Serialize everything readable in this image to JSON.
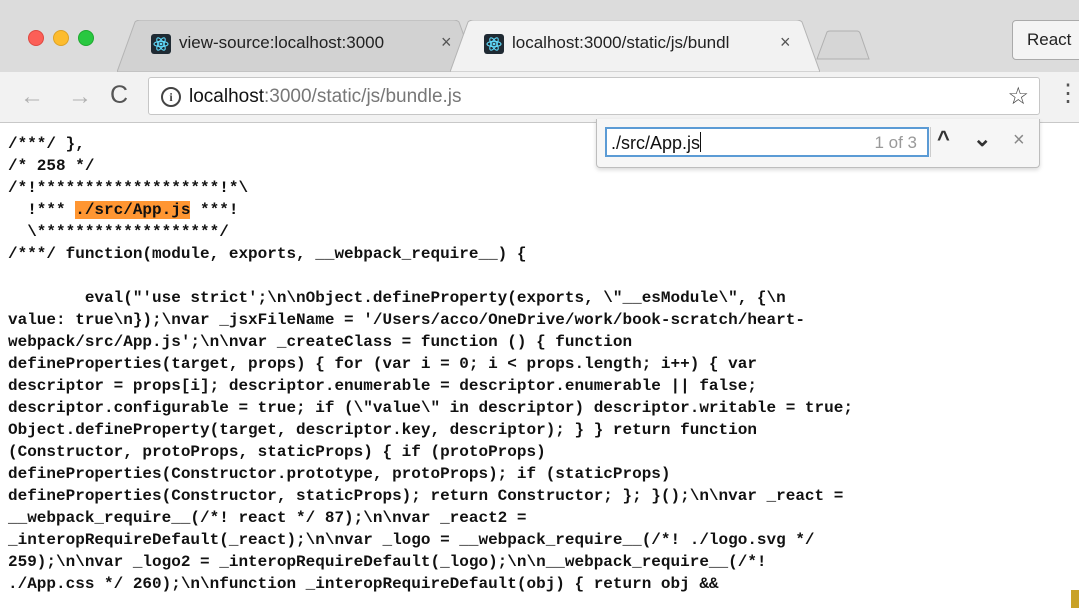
{
  "window": {
    "tabs": [
      {
        "title": "view-source:localhost:3000",
        "close": "×",
        "favicon": "react-icon"
      },
      {
        "title": "localhost:3000/static/js/bundl",
        "close": "×",
        "favicon": "react-icon"
      }
    ],
    "profile_label": "React"
  },
  "toolbar": {
    "back_icon": "←",
    "forward_icon": "→",
    "reload_icon": "C",
    "info_icon": "i",
    "url_host": "localhost",
    "url_path": ":3000/static/js/bundle.js",
    "star_icon": "☆",
    "menu_icon": "⋮"
  },
  "find": {
    "query": "./src/App.js",
    "count": "1 of 3",
    "prev_icon": "^",
    "next_icon": "⌄",
    "close_icon": "×"
  },
  "source": {
    "lines_before": [
      "/***/ },",
      "/* 258 */",
      "/*!*******************!*\\"
    ],
    "highlight_prefix": "  !*** ",
    "highlight_text": "./src/App.js",
    "highlight_suffix": " ***!",
    "lines_after": [
      "  \\*******************/",
      "/***/ function(module, exports, __webpack_require__) {",
      "",
      "        eval(\"'use strict';\\n\\nObject.defineProperty(exports, \\\"__esModule\\\", {\\n",
      "value: true\\n});\\nvar _jsxFileName = '/Users/acco/OneDrive/work/book-scratch/heart-",
      "webpack/src/App.js';\\n\\nvar _createClass = function () { function",
      "defineProperties(target, props) { for (var i = 0; i < props.length; i++) { var",
      "descriptor = props[i]; descriptor.enumerable = descriptor.enumerable || false;",
      "descriptor.configurable = true; if (\\\"value\\\" in descriptor) descriptor.writable = true;",
      "Object.defineProperty(target, descriptor.key, descriptor); } } return function",
      "(Constructor, protoProps, staticProps) { if (protoProps)",
      "defineProperties(Constructor.prototype, protoProps); if (staticProps)",
      "defineProperties(Constructor, staticProps); return Constructor; }; }();\\n\\nvar _react =",
      "__webpack_require__(/*! react */ 87);\\n\\nvar _react2 =",
      "_interopRequireDefault(_react);\\n\\nvar _logo = __webpack_require__(/*! ./logo.svg */",
      "259);\\n\\nvar _logo2 = _interopRequireDefault(_logo);\\n\\n__webpack_require__(/*!",
      "./App.css */ 260);\\n\\nfunction _interopRequireDefault(obj) { return obj &&"
    ]
  }
}
